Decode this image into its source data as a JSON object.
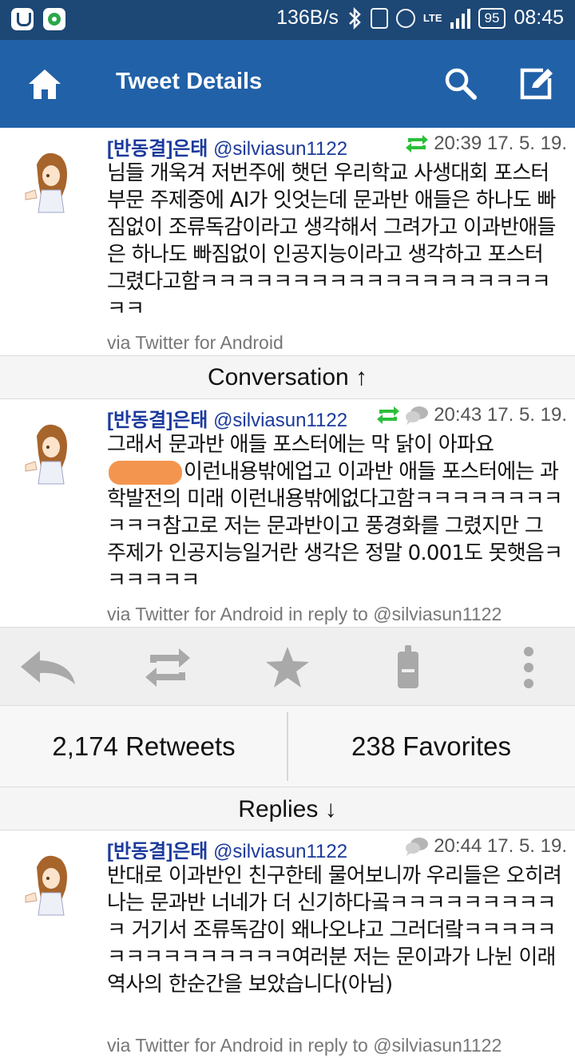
{
  "status_bar": {
    "network_speed": "136B/s",
    "network_type": "LTE",
    "battery": "95",
    "time": "08:45",
    "icons": [
      "u-app-icon",
      "green-app-icon",
      "bluetooth-icon",
      "vibrate-icon",
      "alarm-icon",
      "signal-icon",
      "battery-icon"
    ]
  },
  "app_bar": {
    "title": "Tweet Details",
    "icons": [
      "home-icon",
      "search-icon",
      "compose-icon"
    ],
    "color": "#2161a8"
  },
  "main_tweet": {
    "name": "[반동결]은태",
    "handle": "@silviasun1122",
    "timestamp": "20:39 17. 5. 19.",
    "text": "님들 개욱겨 저번주에 햇던 우리학교 사생대회 포스터부문 주제중에 AI가 잇엇는데 문과반 애들은 하나도 빠짐없이 조류독감이라고 생각해서 그려가고 이과반애들은 하나도 빠짐없이 인공지능이라고 생각하고 포스터 그렸다고함ㅋㅋㅋㅋㅋㅋㅋㅋㅋㅋㅋㅋㅋㅋㅋㅋㅋㅋㅋㅋㅋ",
    "via": "via Twitter for Android"
  },
  "conversation_label": "Conversation ↑",
  "conversation_tweet": {
    "name": "[반동결]은태",
    "handle": "@silviasun1122",
    "timestamp": "20:43 17. 5. 19.",
    "text_before": "그래서 문과반 애들 포스터에는 막 닭이 아파요",
    "text_after": "이런내용밖에업고 이과반 애들 포스터에는 과학발전의 미래 이런내용밖에없다고함ㅋㅋㅋㅋㅋㅋㅋㅋㅋㅋㅋ참고로 저는 문과반이고 풍경화를 그렸지만 그 주제가 인공지능일거란 생각은 정말 0.001도 못햇음ㅋㅋㅋㅋㅋㅋ",
    "via": "via Twitter for Android in reply to @silviasun1122"
  },
  "actions": {
    "icons": [
      "reply-icon",
      "retweet-icon",
      "favorite-star-icon",
      "phone-share-icon",
      "more-options-icon"
    ]
  },
  "stats": {
    "retweets": "2,174 Retweets",
    "favorites": "238 Favorites"
  },
  "replies_label": "Replies ↓",
  "reply_tweet": {
    "name": "[반동결]은태",
    "handle": "@silviasun1122",
    "timestamp": "20:44 17. 5. 19.",
    "text": "반대로 이과반인 친구한테 물어보니까 우리들은 오히려 나는 문과반 너네가 더 신기하다곸ㅋㅋㅋㅋㅋㅋㅋㅋㅋㅋ 거기서 조류독감이 왜나오냐고 그러더랔ㅋㅋㅋㅋㅋㅋㅋㅋㅋㅋㅋㅋㅋㅋㅋ여러분 저는 문이과가 나뉜 이래 역사의 한순간을 보았습니다(아님)",
    "via": "via Twitter for Android in reply to @silviasun1122"
  },
  "colors": {
    "status_bar": "#1d4775",
    "name_link": "#1b3a9c",
    "retweet_green": "#2bbf3a"
  }
}
